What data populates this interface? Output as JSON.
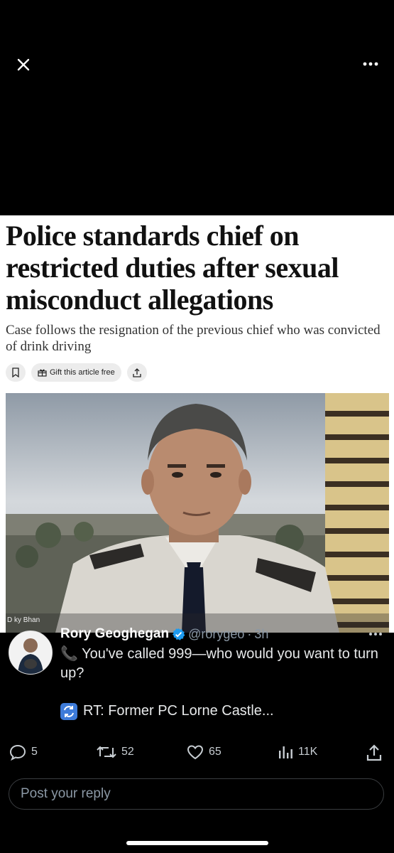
{
  "viewer": {
    "close_icon": "close-icon",
    "more_icon": "more-horizontal-icon"
  },
  "article": {
    "headline": "Police standards chief on restricted duties after sexual misconduct allegations",
    "standfirst": "Case follows the resignation of the previous chief who was convicted of drink driving",
    "actions": {
      "bookmark_icon": "bookmark-icon",
      "gift_label": "Gift this article free",
      "share_icon": "share-icon"
    },
    "photo_caption": "D   ky Bhan"
  },
  "tweet": {
    "author_name": "Rory Geoghegan",
    "verified": true,
    "handle": "@rorygeo",
    "separator": "·",
    "time": "3h",
    "line1": "📞 You've called 999—who would you want to turn up?",
    "retweet_text": "RT: Former PC Lorne Castle..."
  },
  "actions": {
    "replies": "5",
    "retweets": "52",
    "likes": "65",
    "views": "11K"
  },
  "reply": {
    "placeholder": "Post your reply"
  },
  "colors": {
    "background": "#000000",
    "verified_blue": "#1d9bf0",
    "muted_text": "#8b98a5"
  }
}
